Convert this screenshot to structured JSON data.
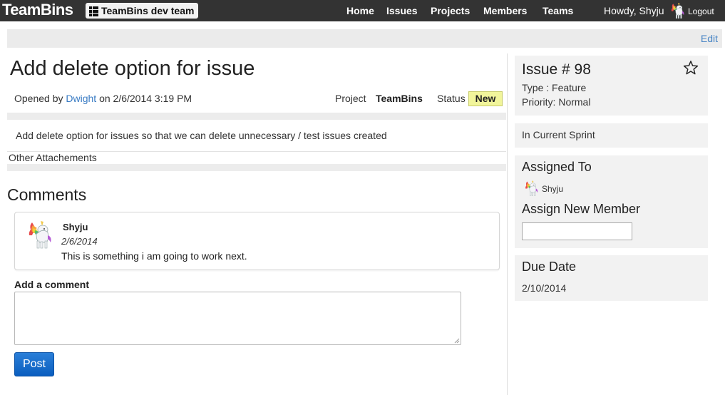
{
  "topbar": {
    "brand": "TeamBins",
    "team_selector": "TeamBins dev team",
    "nav": [
      "Home",
      "Issues",
      "Projects",
      "Members",
      "Teams"
    ],
    "greeting": "Howdy, Shyju",
    "logout": "Logout"
  },
  "toolbar": {
    "edit": "Edit"
  },
  "issue": {
    "title": "Add delete option for issue",
    "opened_by_prefix": "Opened by",
    "author": "Dwight",
    "opened_on": "on 2/6/2014 3:19 PM",
    "project_label": "Project",
    "project": "TeamBins",
    "status_label": "Status",
    "status": "New",
    "description": "Add delete option for issues so that we can delete unnecessary / test issues created",
    "attachments_label": "Other Attachements"
  },
  "comments": {
    "heading": "Comments",
    "items": [
      {
        "author": "Shyju",
        "date": "2/6/2014",
        "text": "This is something i am going to work next."
      }
    ],
    "add_label": "Add a comment",
    "post_button": "Post"
  },
  "sidebar": {
    "issue_number": "Issue # 98",
    "type": "Type : Feature",
    "priority": "Priority: Normal",
    "sprint": "In Current Sprint",
    "assigned_heading": "Assigned To",
    "assignee": "Shyju",
    "assign_new_heading": "Assign New Member",
    "due_heading": "Due Date",
    "due_date": "2/10/2014"
  },
  "icons": {
    "team": "list-icon",
    "avatar": "unicorn-avatar-icon",
    "star": "star-outline-icon"
  },
  "colors": {
    "topbar_bg": "#333333",
    "link": "#3a7cc4",
    "status_badge_bg": "#f1f59b",
    "post_button": "#0b5ebf",
    "panel_bg": "#f2f2f2"
  }
}
